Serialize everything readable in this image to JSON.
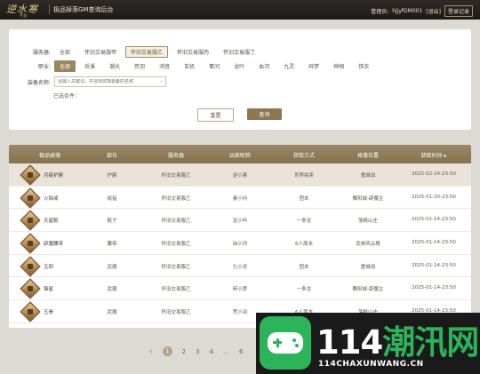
{
  "app": {
    "logo_text": "逆水寒",
    "logo_sub": "手游",
    "title": "极品掉落GM查询后台",
    "user_label": "管理员:",
    "user_name": "hjjyfGM001",
    "logout": "[退出]",
    "switch_account": "登录记录"
  },
  "filters": {
    "server_label": "服务器:",
    "servers": [
      "全部",
      "怀旧交易服甲",
      "怀旧交易服乙",
      "怀旧交易服丙",
      "怀旧交易服丁"
    ],
    "server_selected": "怀旧交易服乙",
    "class_label": "职业:",
    "classes": [
      "全部",
      "岳溪",
      "潮光",
      "荒羽",
      "鸿音",
      "玄机",
      "素问",
      "龙吟",
      "血河",
      "九灵",
      "碎梦",
      "神相",
      "铁衣"
    ],
    "class_selected": "全部",
    "equip_label": "装备名称:",
    "equip_placeholder": "请输入关键词，并选择掉落装备的名称",
    "selected_conditions": "已选条件：",
    "reset": "重置",
    "query": "查询"
  },
  "table": {
    "columns": [
      "极品掉落",
      "部位",
      "服务器",
      "玩家昵称",
      "获取方式",
      "掉落位置",
      "获取时间"
    ],
    "sort_indicator": "▸",
    "rows": [
      {
        "item": "月痕护腕",
        "slot": "护腕",
        "server": "怀旧交易服乙",
        "player": "逆小寒",
        "method": "世界拍卖",
        "location": "童城战",
        "time": "2025-02-14-23:50"
      },
      {
        "item": "火焰戒",
        "slot": "戒指",
        "server": "怀旧交易服乙",
        "player": "素小问",
        "method": "团本",
        "location": "舞阳城-辟魔主",
        "time": "2025-01-20-23:50"
      },
      {
        "item": "天星靴",
        "slot": "鞋子",
        "server": "怀旧交易服乙",
        "player": "龙小吟",
        "method": "一条龙",
        "location": "落枫山庄",
        "time": "2025-01-14-23:50"
      },
      {
        "item": "辟魔腰带",
        "slot": "腰带",
        "server": "怀旧交易服乙",
        "player": "血小河",
        "method": "6人周本",
        "location": "武林风云榜",
        "time": "2025-01-14-23:50"
      },
      {
        "item": "玉刺",
        "slot": "武器",
        "server": "怀旧交易服乙",
        "player": "九小灵",
        "method": "团本",
        "location": "童城战",
        "time": "2025-01-14-23:50"
      },
      {
        "item": "锋星",
        "slot": "武器",
        "server": "怀旧交易服乙",
        "player": "碎小梦",
        "method": "一条龙",
        "location": "舞阳城-辟魔主",
        "time": "2025-01-14-23:50"
      },
      {
        "item": "玉骨",
        "slot": "武器",
        "server": "怀旧交易服乙",
        "player": "荒小羽",
        "method": "6人周本",
        "location": "落枫山庄",
        "time": "2025-01-14-23:50"
      }
    ]
  },
  "pager": {
    "prev": "‹",
    "pages": [
      "1",
      "2",
      "3",
      "4",
      "…",
      "6"
    ],
    "active": "1"
  },
  "watermark": {
    "number": "114",
    "brand": "潮汛网",
    "url": "114CHAXUNWANG.CN",
    "accent_color": "#2bb45a"
  },
  "colors": {
    "accent": "#9b8560",
    "header_bg": "#1d1a18",
    "page_bg": "#ddd9d3"
  }
}
